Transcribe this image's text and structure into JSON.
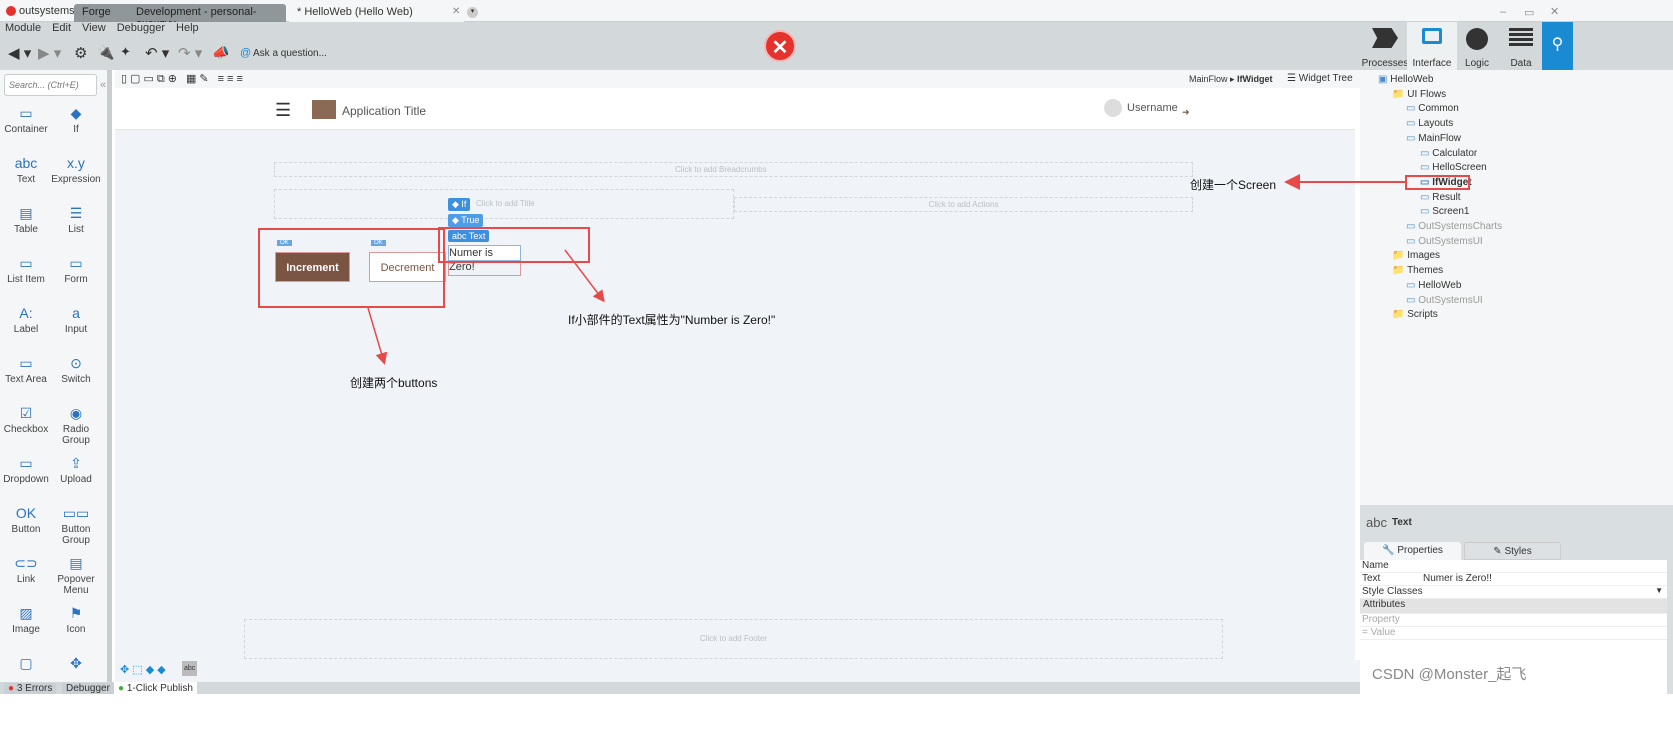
{
  "titlebar": {
    "logo": "outsystems",
    "tabs": [
      "Forge",
      "Development - personal-oxexzyv...",
      "* HelloWeb (Hello Web)"
    ]
  },
  "menu": [
    "Module",
    "Edit",
    "View",
    "Debugger",
    "Help"
  ],
  "toolbar": {
    "ask": "Ask a question..."
  },
  "nav": {
    "items": [
      "Processes",
      "Interface",
      "Logic",
      "Data"
    ]
  },
  "palette": {
    "search_placeholder": "Search... (Ctrl+E)",
    "items": [
      "Container",
      "If",
      "Text",
      "Expression",
      "Table",
      "List",
      "List Item",
      "Form",
      "Label",
      "Input",
      "Text Area",
      "Switch",
      "Checkbox",
      "Radio Group",
      "Dropdown",
      "Upload",
      "Button",
      "Button Group",
      "Link",
      "Popover Menu",
      "Image",
      "Icon",
      "",
      ""
    ],
    "icons": [
      "▭",
      "◆",
      "abc",
      "x.y",
      "▤",
      "☰",
      "▭",
      "▭",
      "A:",
      "a",
      "▭",
      "⊙",
      "☑",
      "◉",
      "▭",
      "⇪",
      "OK",
      "▭▭",
      "⊂⊃",
      "▤",
      "▨",
      "⚑",
      "▢",
      "✥"
    ]
  },
  "breadcrumb": {
    "flow": "MainFlow",
    "screen": "IfWidget"
  },
  "widget_tree_label": "Widget Tree",
  "canvas": {
    "app_title": "Application Title",
    "username": "Username",
    "breadcrumbs_ph": "Click to add Breadcrumbs",
    "title_ph": "Click to add Title",
    "actions_ph": "Click to add Actions",
    "footer_ph": "Click to add Footer",
    "if_tag": "If",
    "true_tag": "True",
    "text_tag": "Text",
    "ok": "OK",
    "increment": "Increment",
    "decrement": "Decrement",
    "text_value": "Numer is Zero!"
  },
  "tree": [
    {
      "label": "HelloWeb",
      "depth": 0
    },
    {
      "label": "UI Flows",
      "depth": 1
    },
    {
      "label": "Common",
      "depth": 2
    },
    {
      "label": "Layouts",
      "depth": 2
    },
    {
      "label": "MainFlow",
      "depth": 2
    },
    {
      "label": "Calculator",
      "depth": 3
    },
    {
      "label": "HelloScreen",
      "depth": 3
    },
    {
      "label": "IfWidget",
      "depth": 3
    },
    {
      "label": "Result",
      "depth": 3
    },
    {
      "label": "Screen1",
      "depth": 3
    },
    {
      "label": "OutSystemsCharts",
      "depth": 2
    },
    {
      "label": "OutSystemsUI",
      "depth": 2
    },
    {
      "label": "Images",
      "depth": 1
    },
    {
      "label": "Themes",
      "depth": 1
    },
    {
      "label": "HelloWeb",
      "depth": 2
    },
    {
      "label": "OutSystemsUI",
      "depth": 2
    },
    {
      "label": "Scripts",
      "depth": 1
    }
  ],
  "props": {
    "icon": "abc",
    "title": "Text",
    "tab_properties": "Properties",
    "tab_styles": "Styles",
    "rows": [
      {
        "k": "Name",
        "v": ""
      },
      {
        "k": "Text",
        "v": "Numer is Zero!!"
      },
      {
        "k": "Style Classes",
        "v": ""
      }
    ],
    "attributes": "Attributes",
    "property_ph": "Property",
    "value_ph": "= Value"
  },
  "status": {
    "errors": "3 Errors",
    "debugger": "Debugger",
    "publish": "1-Click Publish"
  },
  "annotations": {
    "screen": "创建一个Screen",
    "text": "If小部件的Text属性为\"Number is Zero!\"",
    "buttons": "创建两个buttons"
  },
  "watermark": "CSDN @Monster_起飞",
  "colors": {
    "accent": "#1a8ad3",
    "brand_red": "#e5322d",
    "button_brown": "#7a5544",
    "annotation": "#e84a4a"
  }
}
